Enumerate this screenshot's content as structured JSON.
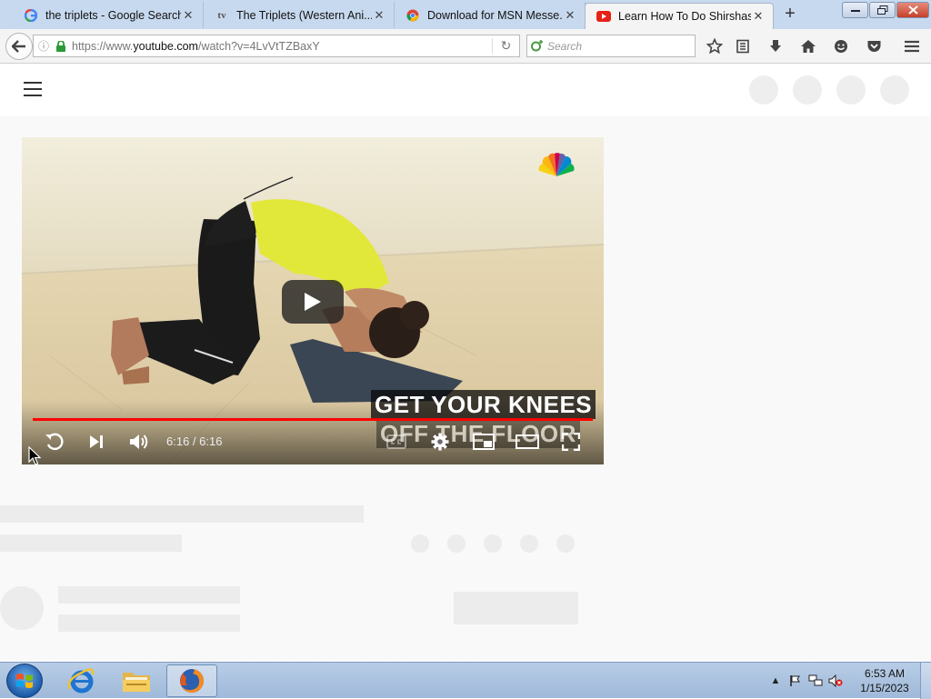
{
  "browser": {
    "tabs": [
      {
        "title": "the triplets - Google Search",
        "icon": "google-icon",
        "close": "✕"
      },
      {
        "title": "The Triplets (Western Ani...",
        "icon": "tv-icon",
        "close": "✕"
      },
      {
        "title": "Download for MSN Messe...",
        "icon": "chrome-icon",
        "close": "✕"
      },
      {
        "title": "Learn How To Do Shirshas...",
        "icon": "youtube-icon",
        "close": "✕",
        "active": true
      }
    ],
    "new_tab": "+",
    "url_prefix": "https://www.",
    "url_domain": "youtube.com",
    "url_path": "/watch?v=4LvVtTZBaxY",
    "search_placeholder": "Search"
  },
  "video": {
    "caption_line1": "GET YOUR KNEES",
    "caption_line2": "OFF THE FLOOR",
    "time": "6:16 / 6:16",
    "progress": 1.0
  },
  "taskbar": {
    "apps": [
      "internet-explorer-icon",
      "file-explorer-icon",
      "firefox-icon"
    ],
    "clock_time": "6:53 AM",
    "clock_date": "1/15/2023"
  },
  "colors": {
    "progress": "#ff0000",
    "titlebar": "#c7d9ef",
    "taskbar": "#b8cde6"
  }
}
